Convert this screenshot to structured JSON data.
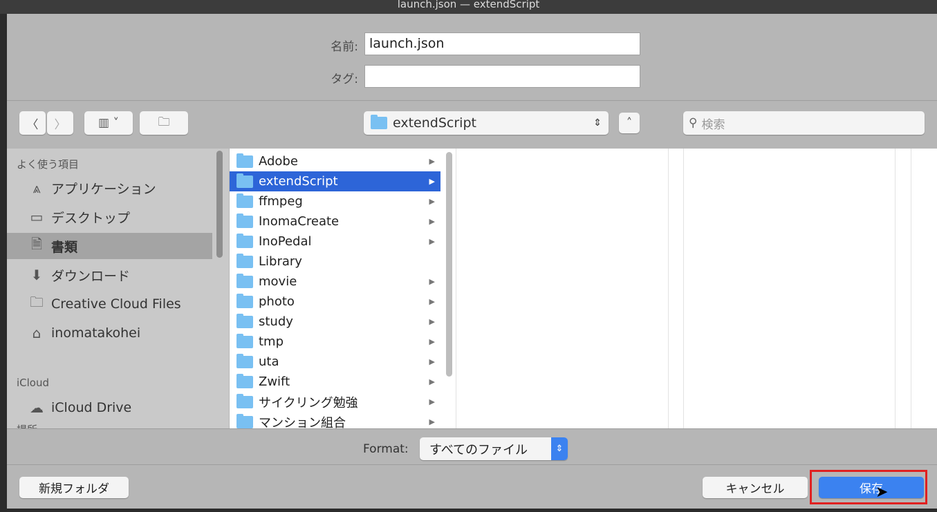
{
  "window_title": "launch.json — extendScript",
  "name_label": "名前:",
  "name_value": "launch.json",
  "tag_label": "タグ:",
  "tag_value": "",
  "location": "extendScript",
  "search_placeholder": "検索",
  "sidebar": {
    "favorites_header": "よく使う項目",
    "items": [
      {
        "label": "アプリケーション",
        "icon": "applications-icon"
      },
      {
        "label": "デスクトップ",
        "icon": "desktop-icon"
      },
      {
        "label": "書類",
        "icon": "documents-icon"
      },
      {
        "label": "ダウンロード",
        "icon": "downloads-icon"
      },
      {
        "label": "Creative Cloud Files",
        "icon": "folder-icon"
      },
      {
        "label": "inomatakohei",
        "icon": "home-icon"
      }
    ],
    "icloud_header": "iCloud",
    "icloud_item": "iCloud Drive",
    "places_header": "場所"
  },
  "folders": [
    "Adobe",
    "extendScript",
    "ffmpeg",
    "InomaCreate",
    "InoPedal",
    "Library",
    "movie",
    "photo",
    "study",
    "tmp",
    "uta",
    "Zwift",
    "サイクリング勉強",
    "マンション組合"
  ],
  "selected_folder": "extendScript",
  "format_label": "Format:",
  "format_value": "すべてのファイル",
  "new_folder": "新規フォルダ",
  "cancel": "キャンセル",
  "save": "保存",
  "colors": {
    "accent": "#2d65d8",
    "highlight": "#e02020"
  }
}
